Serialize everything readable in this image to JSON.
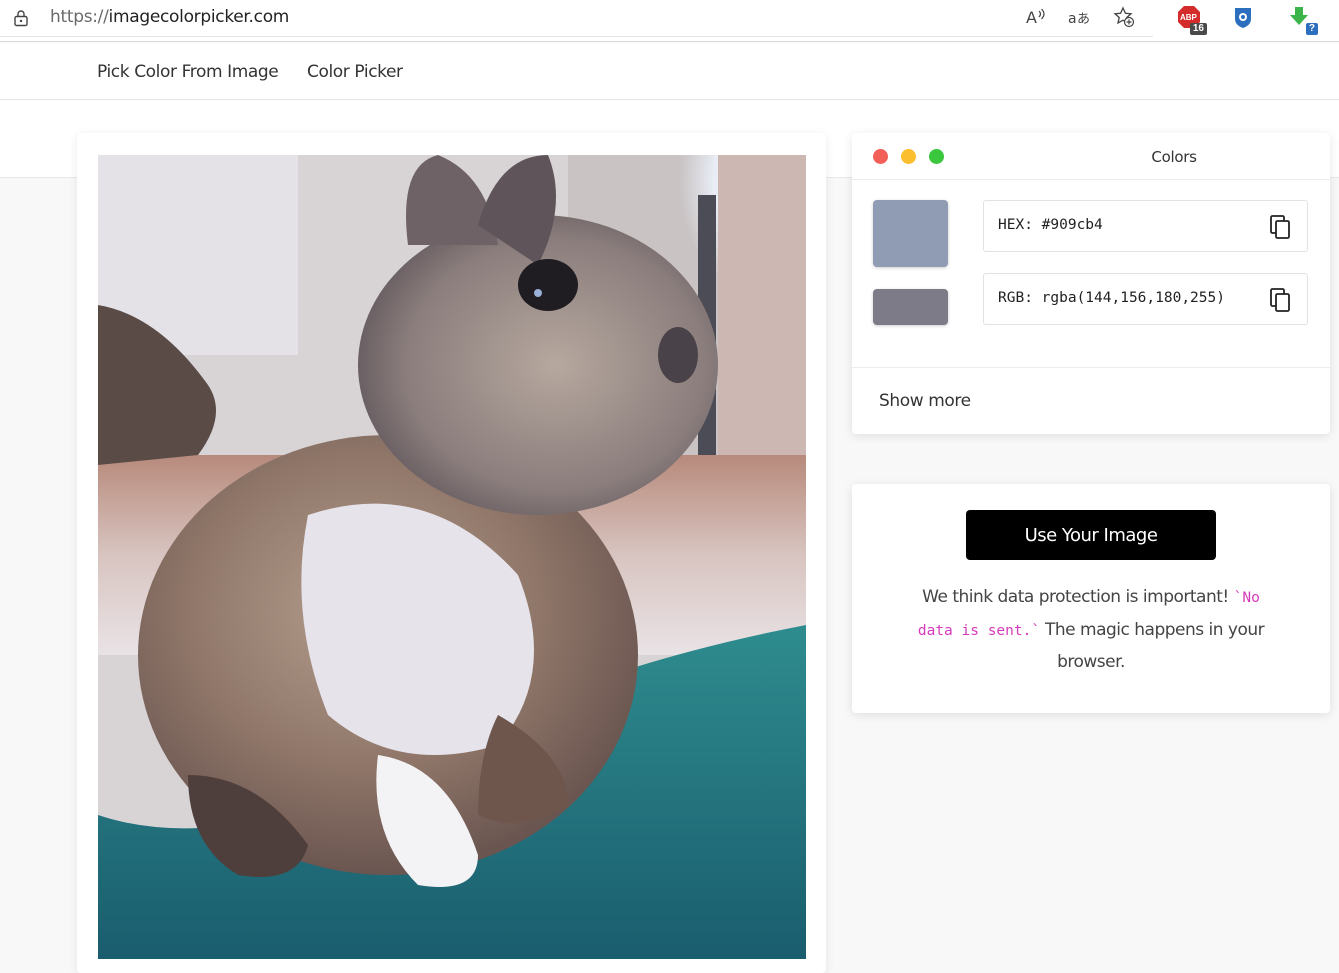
{
  "browser": {
    "url_protocol": "https://",
    "url_domain": "imagecolorpicker.com",
    "toolbar_icons": [
      "read-aloud-icon",
      "translate-icon",
      "add-favorite-icon"
    ],
    "extensions": [
      {
        "name": "adblock-extension-icon",
        "badge": "16"
      },
      {
        "name": "shield-extension-icon",
        "badge": ""
      },
      {
        "name": "download-extension-icon",
        "badge": "?"
      }
    ]
  },
  "nav": {
    "items": [
      {
        "label": "Pick Color From Image"
      },
      {
        "label": "Color Picker"
      }
    ]
  },
  "colors_panel": {
    "title": "Colors",
    "window_dots": [
      "#f25f58",
      "#fbbe2e",
      "#3ac73e"
    ],
    "swatches": [
      "#909cb4",
      "#7e7b88"
    ],
    "hex_text": "HEX: #909cb4",
    "rgb_text": "RGB: rgba(144,156,180,255)",
    "show_more": "Show more"
  },
  "upload": {
    "button_label": "Use Your Image",
    "privacy_before": "We think data protection is important! ",
    "privacy_code": "`No data is sent.`",
    "privacy_after": " The magic happens in your browser."
  }
}
